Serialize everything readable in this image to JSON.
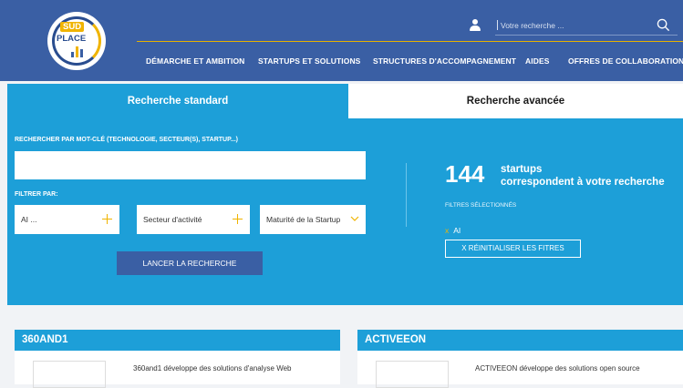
{
  "header": {
    "logo": {
      "top_text": "SUD",
      "bottom_text": "PLACE"
    },
    "search": {
      "placeholder": "Votre recherche ..."
    },
    "nav": [
      "DÉMARCHE ET AMBITION",
      "STARTUPS ET SOLUTIONS",
      "STRUCTURES D'ACCOMPAGNEMENT",
      "AIDES",
      "OFFRES DE COLLABORATION"
    ]
  },
  "tabs": {
    "standard": "Recherche standard",
    "advanced": "Recherche avancée"
  },
  "search_panel": {
    "keyword_label": "RECHERCHER PAR MOT-CLÉ (TECHNOLOGIE, SECTEUR(S), STARTUP...)",
    "keyword_value": "",
    "filter_label": "FILTRER PAR:",
    "filters": [
      "AI ...",
      "Secteur d'activité",
      "Maturité de la Startup"
    ],
    "submit_label": "LANCER LA RECHERCHE"
  },
  "results": {
    "count": "144",
    "line1": "startups",
    "line2": "correspondent à votre recherche",
    "selected_label": "FILTRES SÉLECTIONNÉS",
    "selected_filter": "AI",
    "reset_label": "X RÉINITIALISER LES FITRES"
  },
  "cards": [
    {
      "title": "360AND1",
      "description": "360and1 développe des solutions d'analyse Web"
    },
    {
      "title": "ACTIVEEON",
      "description": "ACTIVEEON développe des solutions open source"
    }
  ],
  "colors": {
    "header_blue": "#3a5fa4",
    "panel_blue": "#1d9fd8",
    "accent_yellow": "#f0b400"
  },
  "icons": {
    "user": "user-icon",
    "search": "search-icon",
    "plus": "plus-icon",
    "chevron": "chevron-down-icon"
  }
}
